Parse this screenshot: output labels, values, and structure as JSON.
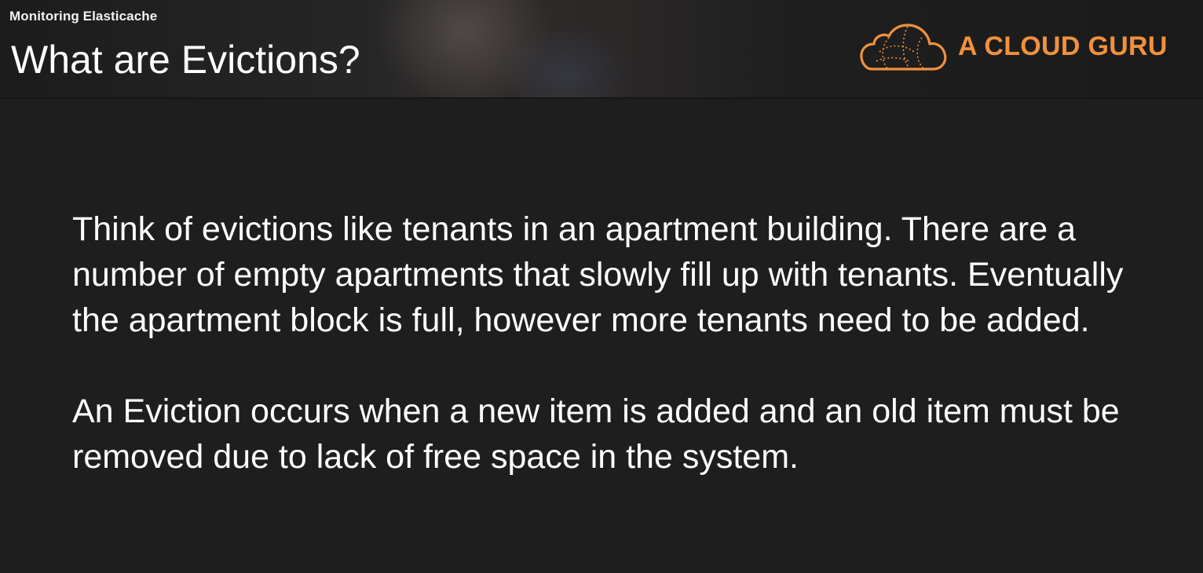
{
  "header": {
    "course_name": "Monitoring Elasticache",
    "title": "What are Evictions?",
    "brand": "A CLOUD GURU",
    "brand_color": "#f0913e",
    "logo_icon": "cloud-logo-icon"
  },
  "body": {
    "paragraphs": [
      "Think of evictions like tenants in an apartment building. There are a number of empty apartments that slowly fill up with tenants. Eventually the apartment block is full, however more tenants need to be added.",
      "An Eviction occurs when a new item is added and an old item must be removed due to lack of free space in the system."
    ]
  }
}
